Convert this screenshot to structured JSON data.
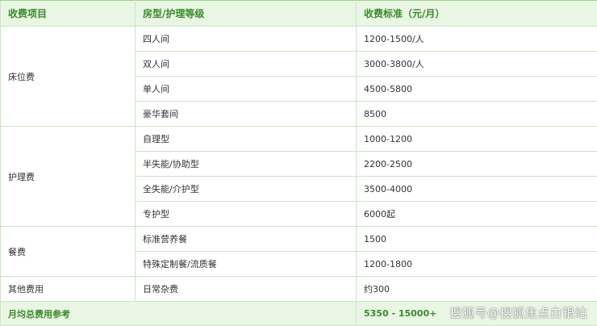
{
  "table": {
    "headers": [
      "收费项目",
      "房型/护理等级",
      "收费标准（元/月）"
    ],
    "groups": [
      {
        "category": "床位费",
        "rows": [
          {
            "level": "四人间",
            "price": "1200-1500/人"
          },
          {
            "level": "双人间",
            "price": "3000-3800/人"
          },
          {
            "level": "单人间",
            "price": "4500-5800"
          },
          {
            "level": "豪华套间",
            "price": "8500"
          }
        ]
      },
      {
        "category": "护理费",
        "rows": [
          {
            "level": "自理型",
            "price": "1000-1200"
          },
          {
            "level": "半失能/协助型",
            "price": "2200-2500"
          },
          {
            "level": "全失能/介护型",
            "price": "3500-4000"
          },
          {
            "level": "专护型",
            "price": "6000起"
          }
        ]
      },
      {
        "category": "餐费",
        "rows": [
          {
            "level": "标准营养餐",
            "price": "1500"
          },
          {
            "level": "特殊定制餐/流质餐",
            "price": "1200-1800"
          }
        ]
      },
      {
        "category": "其他费用",
        "rows": [
          {
            "level": "日常杂费",
            "price": "约300"
          }
        ]
      }
    ],
    "footer": {
      "label": "月均总费用参考",
      "total": "5350 - 15000+"
    }
  },
  "watermark": "搜狐号@搜狐焦点白银站",
  "colors": {
    "header_bg": "#e9f6e4",
    "header_text": "#3a8a2c",
    "border": "#c9e6c2"
  }
}
